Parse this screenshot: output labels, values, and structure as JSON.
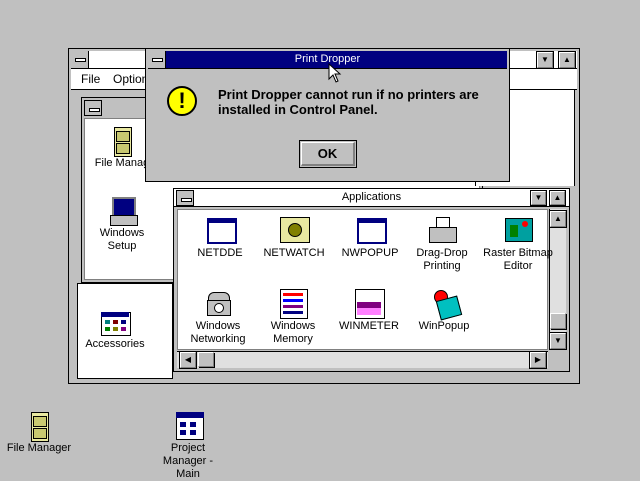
{
  "program_manager": {
    "menu": {
      "file": "File",
      "options": "Option"
    }
  },
  "dialog": {
    "title": "Print Dropper",
    "message_line1": "Print Dropper cannot run if no printers are",
    "message_line2": "installed in Control Panel.",
    "ok_label": "OK"
  },
  "main_group": {
    "icons": [
      {
        "label": "File Manag"
      },
      {
        "label": "Windows",
        "label2": "Setup"
      }
    ]
  },
  "accessories_group": {
    "label": "Accessories"
  },
  "applications": {
    "title": "Applications",
    "icons": [
      {
        "label": "NETDDE"
      },
      {
        "label": "NETWATCH"
      },
      {
        "label": "NWPOPUP"
      },
      {
        "label": "Drag-Drop",
        "label2": "Printing"
      },
      {
        "label": "Raster Bitmap",
        "label2": "Editor"
      },
      {
        "label": "Windows",
        "label2": "Networking"
      },
      {
        "label": "Windows",
        "label2": "Memory"
      },
      {
        "label": "WINMETER"
      },
      {
        "label": "WinPopup"
      }
    ]
  },
  "desktop": {
    "icons": [
      {
        "label": "File Manager"
      },
      {
        "label": "Project",
        "label2": "Manager -",
        "label3": "Main"
      }
    ]
  }
}
